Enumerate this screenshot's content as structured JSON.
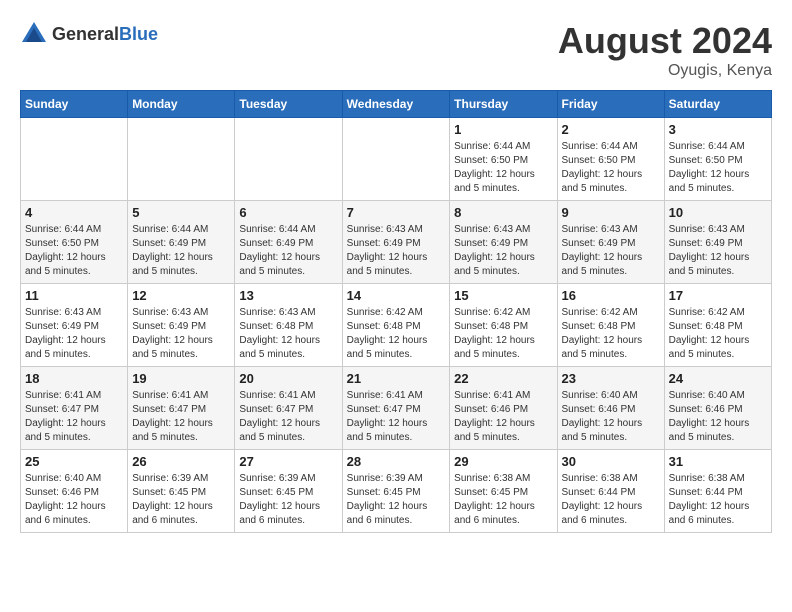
{
  "header": {
    "logo_general": "General",
    "logo_blue": "Blue",
    "month_year": "August 2024",
    "location": "Oyugis, Kenya"
  },
  "weekdays": [
    "Sunday",
    "Monday",
    "Tuesday",
    "Wednesday",
    "Thursday",
    "Friday",
    "Saturday"
  ],
  "weeks": [
    [
      {
        "day": "",
        "sunrise": "",
        "sunset": "",
        "daylight": ""
      },
      {
        "day": "",
        "sunrise": "",
        "sunset": "",
        "daylight": ""
      },
      {
        "day": "",
        "sunrise": "",
        "sunset": "",
        "daylight": ""
      },
      {
        "day": "",
        "sunrise": "",
        "sunset": "",
        "daylight": ""
      },
      {
        "day": "1",
        "sunrise": "Sunrise: 6:44 AM",
        "sunset": "Sunset: 6:50 PM",
        "daylight": "Daylight: 12 hours and 5 minutes."
      },
      {
        "day": "2",
        "sunrise": "Sunrise: 6:44 AM",
        "sunset": "Sunset: 6:50 PM",
        "daylight": "Daylight: 12 hours and 5 minutes."
      },
      {
        "day": "3",
        "sunrise": "Sunrise: 6:44 AM",
        "sunset": "Sunset: 6:50 PM",
        "daylight": "Daylight: 12 hours and 5 minutes."
      }
    ],
    [
      {
        "day": "4",
        "sunrise": "Sunrise: 6:44 AM",
        "sunset": "Sunset: 6:50 PM",
        "daylight": "Daylight: 12 hours and 5 minutes."
      },
      {
        "day": "5",
        "sunrise": "Sunrise: 6:44 AM",
        "sunset": "Sunset: 6:49 PM",
        "daylight": "Daylight: 12 hours and 5 minutes."
      },
      {
        "day": "6",
        "sunrise": "Sunrise: 6:44 AM",
        "sunset": "Sunset: 6:49 PM",
        "daylight": "Daylight: 12 hours and 5 minutes."
      },
      {
        "day": "7",
        "sunrise": "Sunrise: 6:43 AM",
        "sunset": "Sunset: 6:49 PM",
        "daylight": "Daylight: 12 hours and 5 minutes."
      },
      {
        "day": "8",
        "sunrise": "Sunrise: 6:43 AM",
        "sunset": "Sunset: 6:49 PM",
        "daylight": "Daylight: 12 hours and 5 minutes."
      },
      {
        "day": "9",
        "sunrise": "Sunrise: 6:43 AM",
        "sunset": "Sunset: 6:49 PM",
        "daylight": "Daylight: 12 hours and 5 minutes."
      },
      {
        "day": "10",
        "sunrise": "Sunrise: 6:43 AM",
        "sunset": "Sunset: 6:49 PM",
        "daylight": "Daylight: 12 hours and 5 minutes."
      }
    ],
    [
      {
        "day": "11",
        "sunrise": "Sunrise: 6:43 AM",
        "sunset": "Sunset: 6:49 PM",
        "daylight": "Daylight: 12 hours and 5 minutes."
      },
      {
        "day": "12",
        "sunrise": "Sunrise: 6:43 AM",
        "sunset": "Sunset: 6:49 PM",
        "daylight": "Daylight: 12 hours and 5 minutes."
      },
      {
        "day": "13",
        "sunrise": "Sunrise: 6:43 AM",
        "sunset": "Sunset: 6:48 PM",
        "daylight": "Daylight: 12 hours and 5 minutes."
      },
      {
        "day": "14",
        "sunrise": "Sunrise: 6:42 AM",
        "sunset": "Sunset: 6:48 PM",
        "daylight": "Daylight: 12 hours and 5 minutes."
      },
      {
        "day": "15",
        "sunrise": "Sunrise: 6:42 AM",
        "sunset": "Sunset: 6:48 PM",
        "daylight": "Daylight: 12 hours and 5 minutes."
      },
      {
        "day": "16",
        "sunrise": "Sunrise: 6:42 AM",
        "sunset": "Sunset: 6:48 PM",
        "daylight": "Daylight: 12 hours and 5 minutes."
      },
      {
        "day": "17",
        "sunrise": "Sunrise: 6:42 AM",
        "sunset": "Sunset: 6:48 PM",
        "daylight": "Daylight: 12 hours and 5 minutes."
      }
    ],
    [
      {
        "day": "18",
        "sunrise": "Sunrise: 6:41 AM",
        "sunset": "Sunset: 6:47 PM",
        "daylight": "Daylight: 12 hours and 5 minutes."
      },
      {
        "day": "19",
        "sunrise": "Sunrise: 6:41 AM",
        "sunset": "Sunset: 6:47 PM",
        "daylight": "Daylight: 12 hours and 5 minutes."
      },
      {
        "day": "20",
        "sunrise": "Sunrise: 6:41 AM",
        "sunset": "Sunset: 6:47 PM",
        "daylight": "Daylight: 12 hours and 5 minutes."
      },
      {
        "day": "21",
        "sunrise": "Sunrise: 6:41 AM",
        "sunset": "Sunset: 6:47 PM",
        "daylight": "Daylight: 12 hours and 5 minutes."
      },
      {
        "day": "22",
        "sunrise": "Sunrise: 6:41 AM",
        "sunset": "Sunset: 6:46 PM",
        "daylight": "Daylight: 12 hours and 5 minutes."
      },
      {
        "day": "23",
        "sunrise": "Sunrise: 6:40 AM",
        "sunset": "Sunset: 6:46 PM",
        "daylight": "Daylight: 12 hours and 5 minutes."
      },
      {
        "day": "24",
        "sunrise": "Sunrise: 6:40 AM",
        "sunset": "Sunset: 6:46 PM",
        "daylight": "Daylight: 12 hours and 5 minutes."
      }
    ],
    [
      {
        "day": "25",
        "sunrise": "Sunrise: 6:40 AM",
        "sunset": "Sunset: 6:46 PM",
        "daylight": "Daylight: 12 hours and 6 minutes."
      },
      {
        "day": "26",
        "sunrise": "Sunrise: 6:39 AM",
        "sunset": "Sunset: 6:45 PM",
        "daylight": "Daylight: 12 hours and 6 minutes."
      },
      {
        "day": "27",
        "sunrise": "Sunrise: 6:39 AM",
        "sunset": "Sunset: 6:45 PM",
        "daylight": "Daylight: 12 hours and 6 minutes."
      },
      {
        "day": "28",
        "sunrise": "Sunrise: 6:39 AM",
        "sunset": "Sunset: 6:45 PM",
        "daylight": "Daylight: 12 hours and 6 minutes."
      },
      {
        "day": "29",
        "sunrise": "Sunrise: 6:38 AM",
        "sunset": "Sunset: 6:45 PM",
        "daylight": "Daylight: 12 hours and 6 minutes."
      },
      {
        "day": "30",
        "sunrise": "Sunrise: 6:38 AM",
        "sunset": "Sunset: 6:44 PM",
        "daylight": "Daylight: 12 hours and 6 minutes."
      },
      {
        "day": "31",
        "sunrise": "Sunrise: 6:38 AM",
        "sunset": "Sunset: 6:44 PM",
        "daylight": "Daylight: 12 hours and 6 minutes."
      }
    ]
  ]
}
